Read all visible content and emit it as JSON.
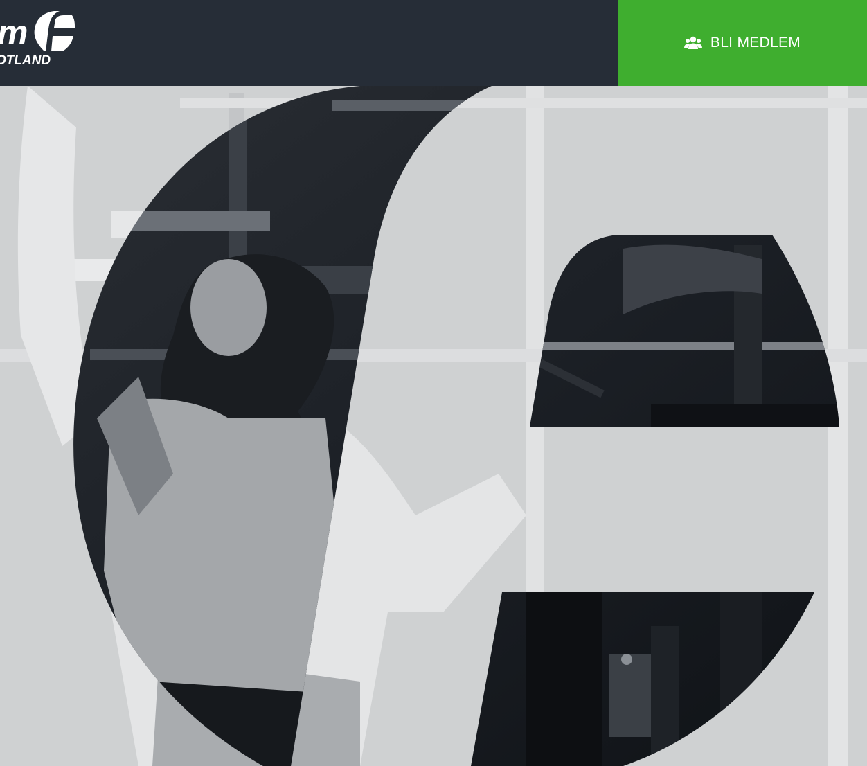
{
  "header": {
    "logo": {
      "word": "m",
      "sub": "OTLAND",
      "icon": "fitness-f-logo-icon"
    },
    "cta": {
      "label": "BLI MEDLEM",
      "icon": "users-group-icon"
    }
  },
  "hero": {
    "image_description_icon": "gym-woman-photo",
    "overlay_icon": "big-f-letter-mark"
  },
  "colors": {
    "header_bg": "#262d37",
    "cta_bg": "#3fae2f",
    "text_on_dark": "#ffffff",
    "overlay_light": "#d9dadb"
  }
}
